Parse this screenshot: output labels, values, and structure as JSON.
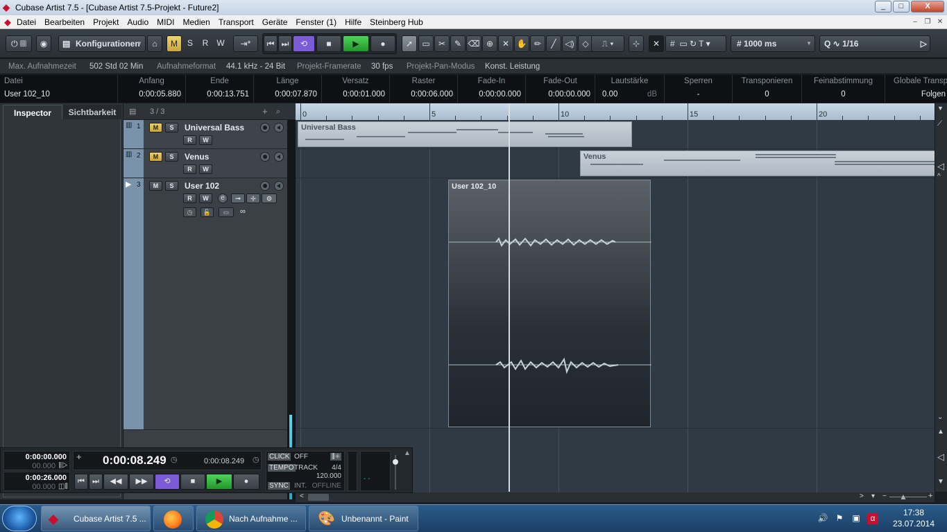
{
  "window": {
    "title": "Cubase Artist 7.5 - [Cubase Artist 7.5-Projekt - Future2]",
    "buttons": [
      "_",
      "□",
      "X"
    ]
  },
  "menu": [
    "Datei",
    "Bearbeiten",
    "Projekt",
    "Audio",
    "MIDI",
    "Medien",
    "Transport",
    "Geräte",
    "Fenster (1)",
    "Hilfe",
    "Steinberg Hub"
  ],
  "toolbar": {
    "config_label": "Konfigurationen",
    "mode_buttons": [
      "M",
      "S",
      "R",
      "W"
    ],
    "grid_value": "1000 ms",
    "quantize_value": "1/16",
    "accent_yellow": "#e8c547",
    "loop_color": "#7b5cd6",
    "play_color": "#2fbf3a"
  },
  "infoline": {
    "max_rec_label": "Max. Aufnahmezeit",
    "max_rec_value": "502 Std 02 Min",
    "format_label": "Aufnahmeformat",
    "format_value": "44.1 kHz - 24 Bit",
    "framerate_label": "Projekt-Framerate",
    "framerate_value": "30 fps",
    "pan_label": "Projekt-Pan-Modus",
    "pan_value": "Konst. Leistung"
  },
  "eventinfo": {
    "columns": [
      {
        "h": "Datei",
        "v": "User 102_10"
      },
      {
        "h": "Anfang",
        "v": "0:00:05.880"
      },
      {
        "h": "Ende",
        "v": "0:00:13.751"
      },
      {
        "h": "Länge",
        "v": "0:00:07.870"
      },
      {
        "h": "Versatz",
        "v": "0:00:01.000"
      },
      {
        "h": "Raster",
        "v": "0:00:06.000"
      },
      {
        "h": "Fade-In",
        "v": "0:00:00.000"
      },
      {
        "h": "Fade-Out",
        "v": "0:00:00.000"
      },
      {
        "h": "Lautstärke",
        "v": "0.00",
        "unit": "dB"
      },
      {
        "h": "Sperren",
        "v": "-"
      },
      {
        "h": "Transponieren",
        "v": "0"
      },
      {
        "h": "Feinabstimmung",
        "v": "0"
      },
      {
        "h": "Globale Transp",
        "v": "Folgen"
      }
    ]
  },
  "inspector": {
    "tabs": [
      "Inspector",
      "Sichtbarkeit"
    ]
  },
  "tracklist": {
    "count": "3 / 3",
    "tracks": [
      {
        "num": "1",
        "name": "Universal Bass",
        "m": "M",
        "s": "S",
        "r": "R",
        "w": "W"
      },
      {
        "num": "2",
        "name": "Venus",
        "m": "M",
        "s": "S",
        "r": "R",
        "w": "W"
      },
      {
        "num": "3",
        "name": "User 102",
        "m": "M",
        "s": "S",
        "r": "R",
        "w": "W",
        "e": "e"
      }
    ]
  },
  "ruler": {
    "labels": [
      "0",
      "5",
      "10",
      "15",
      "20"
    ]
  },
  "parts": {
    "part1": "Universal Bass",
    "part2": "Venus",
    "audio": "User 102_10"
  },
  "transport": {
    "left_pos_1": "0:00:00.000",
    "left_sub_1": "00.000",
    "left_pos_2": "0:00:26.000",
    "left_sub_2": "00.000",
    "main_time": "0:00:08.249",
    "secondary_time": "0:00:08.249",
    "click": "CLICK",
    "click_state": "OFF",
    "tempo": "TEMPO",
    "tempo_mode": "TRACK",
    "signature": "4/4",
    "bpm": "120.000",
    "sync": "SYNC",
    "sync_mode": "INT.",
    "sync_state": "OFFLINE"
  },
  "taskbar": {
    "tasks": [
      "Cubase Artist 7.5 ...",
      "",
      "Nach Aufnahme ...",
      "Unbenannt - Paint"
    ],
    "time": "17:38",
    "date": "23.07.2014"
  }
}
